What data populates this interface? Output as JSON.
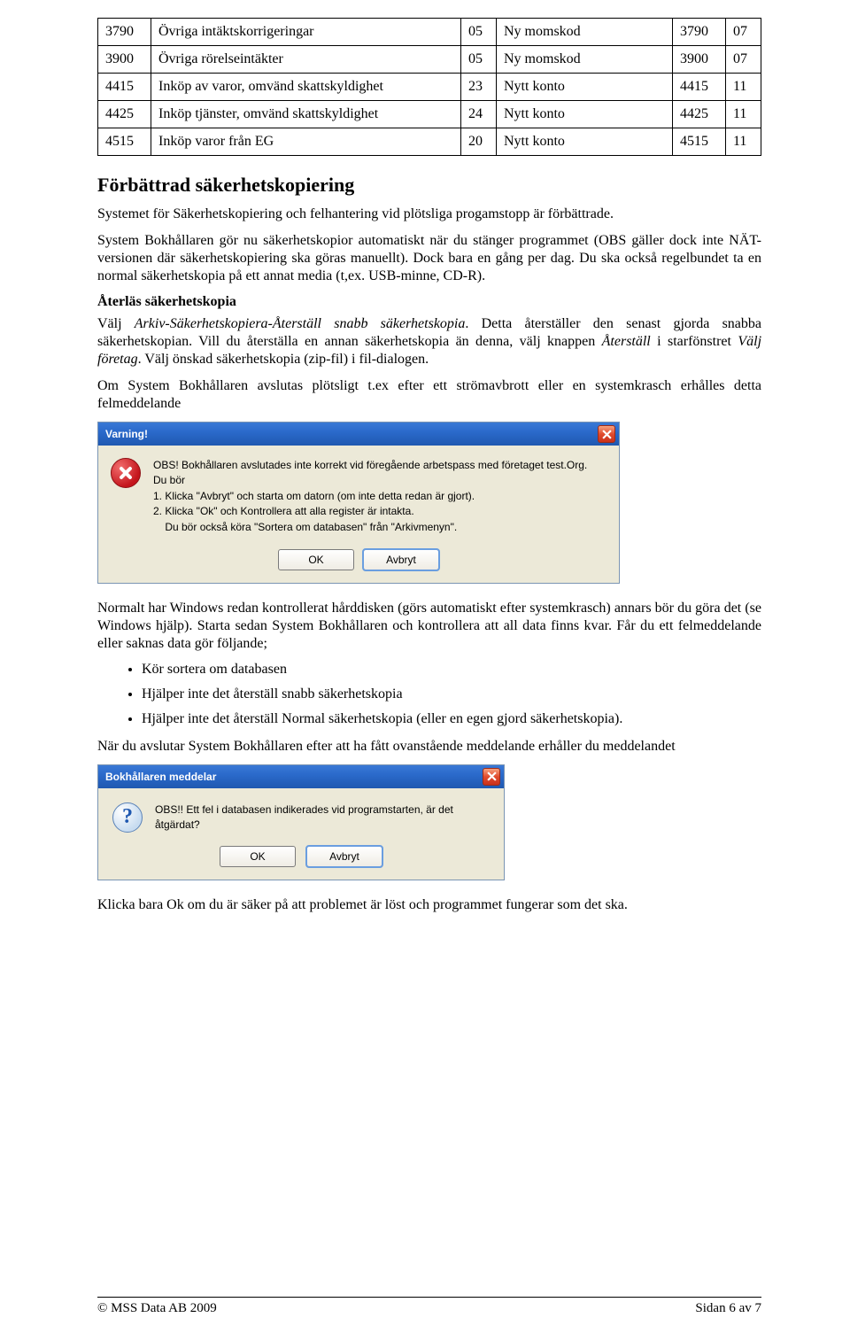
{
  "table": {
    "rows": [
      {
        "c1": "3790",
        "c2": "Övriga intäktskorrigeringar",
        "c3": "05",
        "c4": "Ny momskod",
        "c5": "3790",
        "c6": "07"
      },
      {
        "c1": "3900",
        "c2": "Övriga rörelseintäkter",
        "c3": "05",
        "c4": "Ny momskod",
        "c5": "3900",
        "c6": "07"
      },
      {
        "c1": "4415",
        "c2": "Inköp av varor, omvänd skattskyldighet",
        "c3": "23",
        "c4": "Nytt konto",
        "c5": "4415",
        "c6": "11"
      },
      {
        "c1": "4425",
        "c2": "Inköp tjänster, omvänd skattskyldighet",
        "c3": "24",
        "c4": "Nytt konto",
        "c5": "4425",
        "c6": "11"
      },
      {
        "c1": "4515",
        "c2": "Inköp varor från EG",
        "c3": "20",
        "c4": "Nytt konto",
        "c5": "4515",
        "c6": "11"
      }
    ]
  },
  "section": {
    "heading": "Förbättrad säkerhetskopiering",
    "p1": "Systemet för Säkerhetskopiering och felhantering vid plötsliga progamstopp är förbättrade.",
    "p2": "System Bokhållaren gör nu säkerhetskopior automatiskt när du stänger programmet (OBS gäller dock inte NÄT-versionen där säkerhetskopiering ska göras manuellt). Dock bara en gång per dag. Du ska också regelbundet ta en normal säkerhetskopia på ett annat media (t,ex. USB-minne, CD-R).",
    "subhead": "Återläs säkerhetskopia",
    "p3a": "Välj ",
    "p3i": "Arkiv-Säkerhetskopiera-Återställ snabb säkerhetskopia",
    "p3b": ". Detta återställer den senast gjorda snabba säkerhetskopian. Vill du återställa en annan säkerhetskopia än denna, välj knappen ",
    "p3i2": "Återställ",
    "p3c": " i starfönstret ",
    "p3i3": "Välj företag",
    "p3d": ". Välj önskad säkerhetskopia (zip-fil) i fil-dialogen.",
    "p4": "Om System Bokhållaren avslutas plötsligt t.ex efter ett strömavbrott eller en systemkrasch erhålles detta felmeddelande"
  },
  "dlg1": {
    "title": "Varning!",
    "l1": "OBS! Bokhållaren avslutades inte korrekt vid föregående arbetspass med företaget test.Org.",
    "l2": "Du bör",
    "l3": "1. Klicka \"Avbryt\" och starta om datorn (om inte detta redan är gjort).",
    "l4": "2. Klicka \"Ok\" och Kontrollera att alla register är intakta.",
    "l5": "    Du bör också köra \"Sortera om databasen\" från \"Arkivmenyn\".",
    "ok": "OK",
    "cancel": "Avbryt"
  },
  "after_dlg1": {
    "p1": "Normalt har Windows redan kontrollerat hårddisken (görs automatiskt efter systemkrasch) annars bör du göra det (se Windows hjälp). Starta sedan System Bokhållaren och kontrollera att all data finns kvar. Får du ett felmeddelande eller saknas data gör följande;",
    "b1": "Kör sortera om databasen",
    "b2": "Hjälper inte det återställ snabb säkerhetskopia",
    "b3": "Hjälper inte det återställ Normal säkerhetskopia (eller en egen gjord säkerhetskopia).",
    "p2": "När du avslutar System Bokhållaren efter att ha fått ovanstående meddelande erhåller du meddelandet"
  },
  "dlg2": {
    "title": "Bokhållaren meddelar",
    "text": "OBS!! Ett fel i databasen indikerades vid programstarten, är det åtgärdat?",
    "ok": "OK",
    "cancel": "Avbryt"
  },
  "final_p": "Klicka bara Ok om du är säker på att problemet är löst och programmet fungerar som det ska.",
  "footer": {
    "left": "© MSS Data AB 2009",
    "right": "Sidan 6 av 7"
  }
}
